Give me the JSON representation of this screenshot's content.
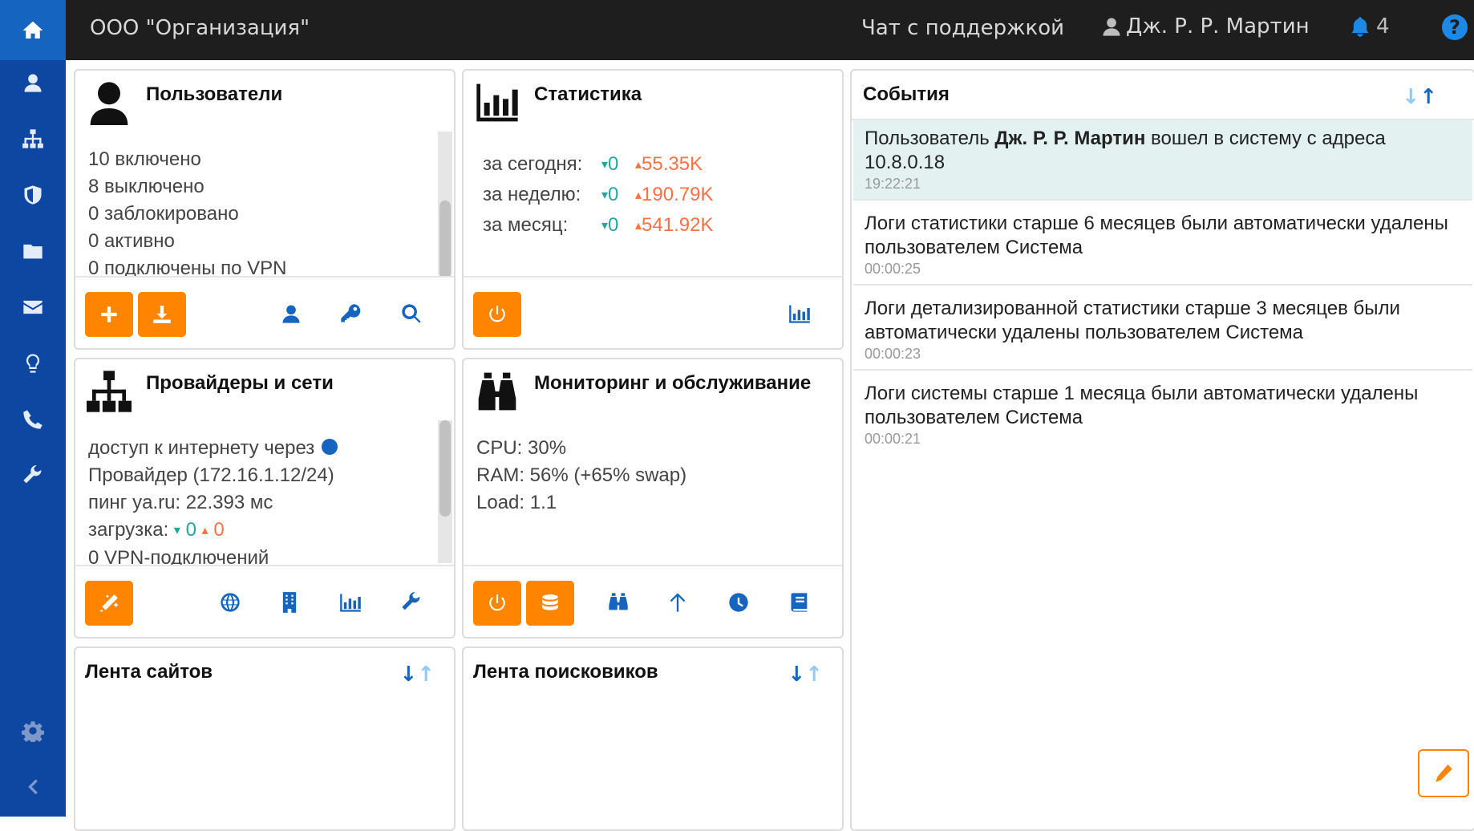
{
  "topbar": {
    "org_name": "ООО \"Организация\"",
    "support_label": "Чат с поддержкой",
    "user_name": "Дж. Р. Р. Мартин",
    "notifications_count": "4",
    "help_label": "?"
  },
  "sidebar": {
    "items": [
      "home-icon",
      "user-icon",
      "sitemap-icon",
      "shield-icon",
      "folder-icon",
      "envelope-icon",
      "lightbulb-icon",
      "phone-icon",
      "wrench-icon",
      "gear-icon",
      "chevron-left-icon"
    ]
  },
  "users": {
    "title": "Пользователи",
    "lines": [
      "10 включено",
      "8 выключено",
      "0 заблокировано",
      "0 активно",
      "0 подключены по VPN"
    ]
  },
  "stats": {
    "title": "Статистика",
    "rows": [
      {
        "label": "за сегодня:",
        "down": "0",
        "up": "55.35K"
      },
      {
        "label": "за неделю:",
        "down": "0",
        "up": "190.79K"
      },
      {
        "label": "за месяц:",
        "down": "0",
        "up": "541.92K"
      }
    ]
  },
  "providers": {
    "title": "Провайдеры и сети",
    "line1": "доступ к интернету через",
    "line2": "Провайдер (172.16.1.12/24)",
    "line3": "пинг ya.ru: 22.393 мс",
    "load_label": "загрузка:",
    "load_down": "0",
    "load_up": "0",
    "line5": "0 VPN-подключений"
  },
  "monitoring": {
    "title": "Мониторинг и обслуживание",
    "lines": [
      "CPU: 30%",
      "RAM: 56% (+65% swap)",
      "Load: 1.1"
    ]
  },
  "sites_feed": {
    "title": "Лента сайтов"
  },
  "search_feed": {
    "title": "Лента поисковиков"
  },
  "events": {
    "title": "События",
    "items": [
      {
        "prefix": "Пользователь ",
        "bold": "Дж. Р. Р. Мартин",
        "suffix": " вошел в систему с адреса 10.8.0.18",
        "time": "19:22:21"
      },
      {
        "text": "Логи статистики старше 6 месяцев были автоматически удалены пользователем Система",
        "time": "00:00:25"
      },
      {
        "text": "Логи детализированной статистики старше 3 месяцев были автоматически удалены пользователем Система",
        "time": "00:00:23"
      },
      {
        "text": "Логи системы старше 1 месяца были автоматически удалены пользователем Система",
        "time": "00:00:21"
      }
    ]
  },
  "colors": {
    "accent": "#ff8500",
    "sidebar": "#0d47a1",
    "topbar": "#1e1e1e",
    "link": "#1565c0",
    "down": "#26a69a",
    "up": "#ff7043"
  }
}
